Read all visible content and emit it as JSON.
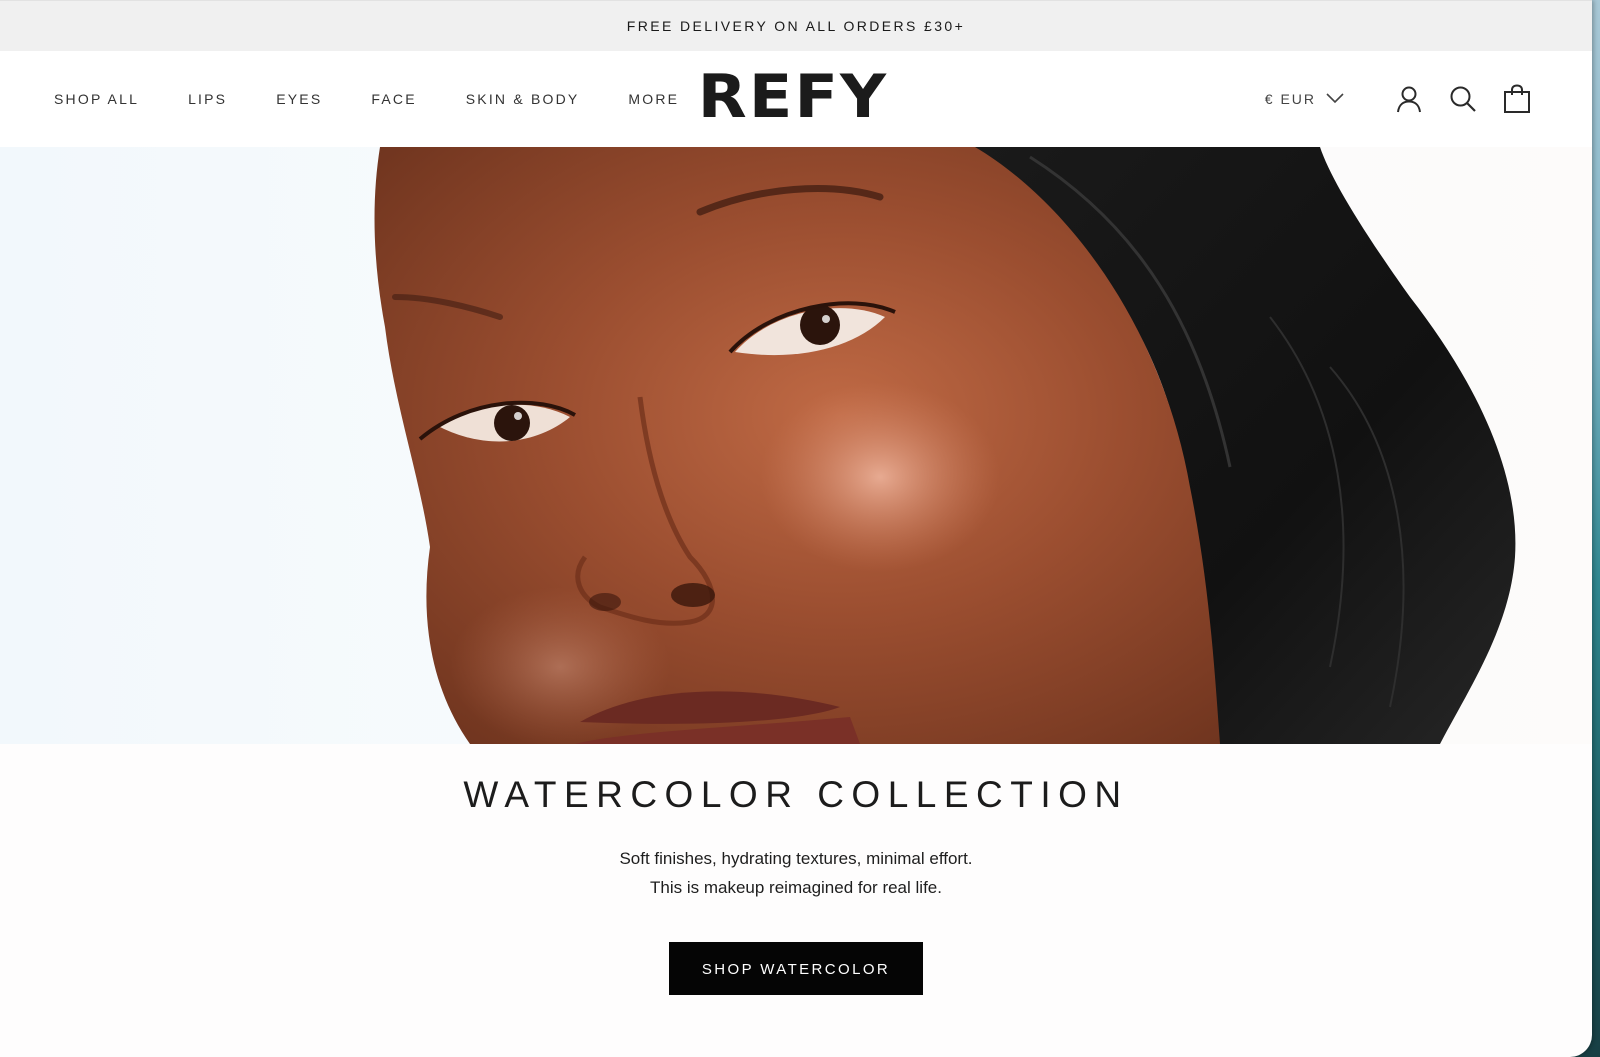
{
  "announcement": {
    "text": "FREE DELIVERY ON ALL ORDERS £30+"
  },
  "header": {
    "nav": [
      {
        "label": "SHOP ALL"
      },
      {
        "label": "LIPS"
      },
      {
        "label": "EYES"
      },
      {
        "label": "FACE"
      },
      {
        "label": "SKIN & BODY"
      },
      {
        "label": "MORE"
      }
    ],
    "logo": "REFY",
    "currency": "€ EUR",
    "icons": [
      "chevron-down-icon",
      "account-icon",
      "search-icon",
      "cart-icon"
    ]
  },
  "hero": {
    "image": "close-up portrait of a woman wearing a black head wrap"
  },
  "collection": {
    "title": "WATERCOLOR COLLECTION",
    "subtitle_line1": "Soft finishes, hydrating textures, minimal effort.",
    "subtitle_line2": "This is makeup reimagined for real life.",
    "cta": "SHOP WATERCOLOR"
  },
  "colors": {
    "announcement_bg": "#f0f0f0",
    "cta_bg": "#050505",
    "cta_text": "#ffffff",
    "text": "#1c1c1c"
  }
}
